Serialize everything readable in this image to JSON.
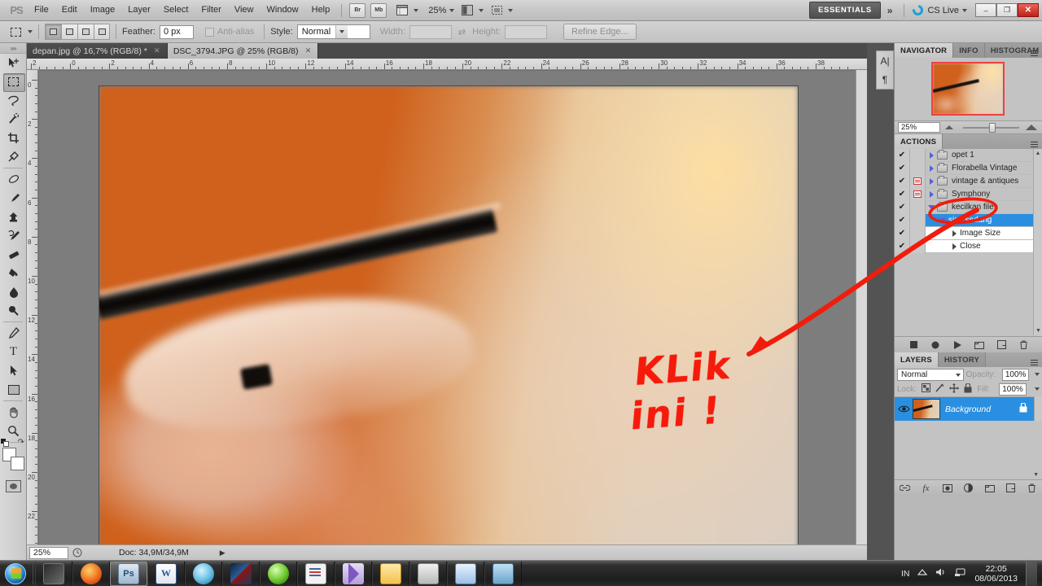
{
  "app": {
    "name": "Adobe Photoshop",
    "logo": "PS",
    "workspace": "ESSENTIALS",
    "cslive": "CS Live",
    "zoom_menu": "25%"
  },
  "menubar": {
    "items": [
      "File",
      "Edit",
      "Image",
      "Layer",
      "Select",
      "Filter",
      "View",
      "Window",
      "Help"
    ],
    "bridge": "Br",
    "minibridge": "Mb",
    "chevrons": "»",
    "window_buttons": {
      "minimize": "–",
      "restore": "❐",
      "close": "✕"
    }
  },
  "optionsbar": {
    "feather_label": "Feather:",
    "feather_value": "0 px",
    "antialias_label": "Anti-alias",
    "style_label": "Style:",
    "style_value": "Normal",
    "width_label": "Width:",
    "width_value": "",
    "height_label": "Height:",
    "height_value": "",
    "swap_glyph": "⇄",
    "refine_edge": "Refine Edge..."
  },
  "tabs": [
    {
      "title": "depan.jpg @ 16,7% (RGB/8) *",
      "active": false,
      "close": "✕"
    },
    {
      "title": "DSC_3794.JPG @ 25% (RGB/8)",
      "active": true,
      "close": "✕"
    }
  ],
  "rulers": {
    "horizontal": [
      "2",
      "0",
      "2",
      "4",
      "6",
      "8",
      "10",
      "12",
      "14",
      "16",
      "18",
      "20",
      "22",
      "24",
      "26",
      "28",
      "30",
      "32",
      "34",
      "36",
      "38"
    ],
    "vertical": [
      "0",
      "2",
      "4",
      "6",
      "8",
      "10",
      "12",
      "14",
      "16",
      "18",
      "20",
      "22"
    ]
  },
  "canvas": {
    "annotation_text": "KLik ini !",
    "annotation_color": "#f21c0c"
  },
  "statusbar": {
    "zoom": "25%",
    "doc_info": "Doc: 34,9M/34,9M",
    "arrow": "▶"
  },
  "toolbar": {
    "tools": [
      {
        "name": "move-tool",
        "glyph": "⮜"
      },
      {
        "name": "rectangular-marquee-tool",
        "glyph": ""
      },
      {
        "name": "lasso-tool",
        "glyph": ""
      },
      {
        "name": "quick-selection-tool",
        "glyph": ""
      },
      {
        "name": "crop-tool",
        "glyph": ""
      },
      {
        "name": "eyedropper-tool",
        "glyph": ""
      },
      {
        "name": "spot-healing-brush-tool",
        "glyph": ""
      },
      {
        "name": "brush-tool",
        "glyph": ""
      },
      {
        "name": "clone-stamp-tool",
        "glyph": ""
      },
      {
        "name": "history-brush-tool",
        "glyph": ""
      },
      {
        "name": "eraser-tool",
        "glyph": ""
      },
      {
        "name": "gradient-tool",
        "glyph": ""
      },
      {
        "name": "blur-tool",
        "glyph": ""
      },
      {
        "name": "dodge-tool",
        "glyph": ""
      },
      {
        "name": "pen-tool",
        "glyph": ""
      },
      {
        "name": "type-tool",
        "glyph": "T"
      },
      {
        "name": "path-selection-tool",
        "glyph": ""
      },
      {
        "name": "rectangle-tool",
        "glyph": ""
      },
      {
        "name": "hand-tool",
        "glyph": ""
      },
      {
        "name": "zoom-tool",
        "glyph": ""
      }
    ],
    "selected": "rectangular-marquee-tool"
  },
  "navigator": {
    "tabs": [
      "NAVIGATOR",
      "INFO",
      "HISTOGRAM"
    ],
    "active_tab": "NAVIGATOR",
    "zoom_value": "25%"
  },
  "actions": {
    "tab": "ACTIONS",
    "rows": [
      {
        "name": "opet 1",
        "checked": true,
        "dialog": false,
        "expanded": false,
        "type": "set",
        "selected": false,
        "indent": 0
      },
      {
        "name": "Florabella Vintage",
        "checked": true,
        "dialog": false,
        "expanded": false,
        "type": "set",
        "selected": false,
        "indent": 0
      },
      {
        "name": "vintage & antiques",
        "checked": true,
        "dialog": true,
        "expanded": false,
        "type": "set",
        "selected": false,
        "indent": 0
      },
      {
        "name": "Symphony",
        "checked": true,
        "dialog": true,
        "expanded": false,
        "type": "set",
        "selected": false,
        "indent": 0
      },
      {
        "name": "kecilkan file",
        "checked": true,
        "dialog": false,
        "expanded": true,
        "type": "set",
        "selected": false,
        "indent": 0
      },
      {
        "name": "size sedang",
        "checked": true,
        "dialog": false,
        "expanded": true,
        "type": "action",
        "selected": true,
        "indent": 1
      },
      {
        "name": "Image Size",
        "checked": true,
        "dialog": false,
        "expanded": false,
        "type": "step",
        "selected": false,
        "indent": 2,
        "white": true
      },
      {
        "name": "Close",
        "checked": true,
        "dialog": false,
        "expanded": false,
        "type": "step",
        "selected": false,
        "indent": 2,
        "white": true
      }
    ],
    "footer_buttons": [
      "stop-button",
      "record-button",
      "play-button",
      "new-set-button",
      "new-action-button",
      "delete-button"
    ]
  },
  "layers": {
    "tabs": [
      "LAYERS",
      "HISTORY"
    ],
    "active_tab": "LAYERS",
    "blend_mode": "Normal",
    "opacity_label": "Opacity:",
    "opacity_value": "100%",
    "lock_label": "Lock:",
    "fill_label": "Fill:",
    "fill_value": "100%",
    "rows": [
      {
        "name": "Background",
        "visible": true,
        "locked": true,
        "selected": true
      }
    ],
    "footer_buttons": [
      "link-layers-button",
      "layer-style-button",
      "layer-mask-button",
      "adjustment-layer-button",
      "new-group-button",
      "new-layer-button",
      "delete-layer-button"
    ]
  },
  "taskbar": {
    "start": "start-orb",
    "items": [
      {
        "name": "taskbar-item-media",
        "active": false
      },
      {
        "name": "taskbar-item-firefox",
        "active": false
      },
      {
        "name": "taskbar-item-photoshop",
        "active": true
      },
      {
        "name": "taskbar-item-word",
        "active": false
      },
      {
        "name": "taskbar-item-media-player",
        "active": false
      },
      {
        "name": "taskbar-item-video",
        "active": false
      },
      {
        "name": "taskbar-item-app-green",
        "active": false
      },
      {
        "name": "taskbar-item-notepad",
        "active": false
      },
      {
        "name": "taskbar-item-movie-maker",
        "active": false
      },
      {
        "name": "taskbar-item-explorer",
        "active": false
      },
      {
        "name": "taskbar-item-printer",
        "active": false
      },
      {
        "name": "taskbar-item-monitor",
        "active": false
      },
      {
        "name": "taskbar-item-photos",
        "active": false
      }
    ],
    "tray": {
      "language": "IN",
      "time": "22:05",
      "date": "08/06/2013"
    }
  }
}
